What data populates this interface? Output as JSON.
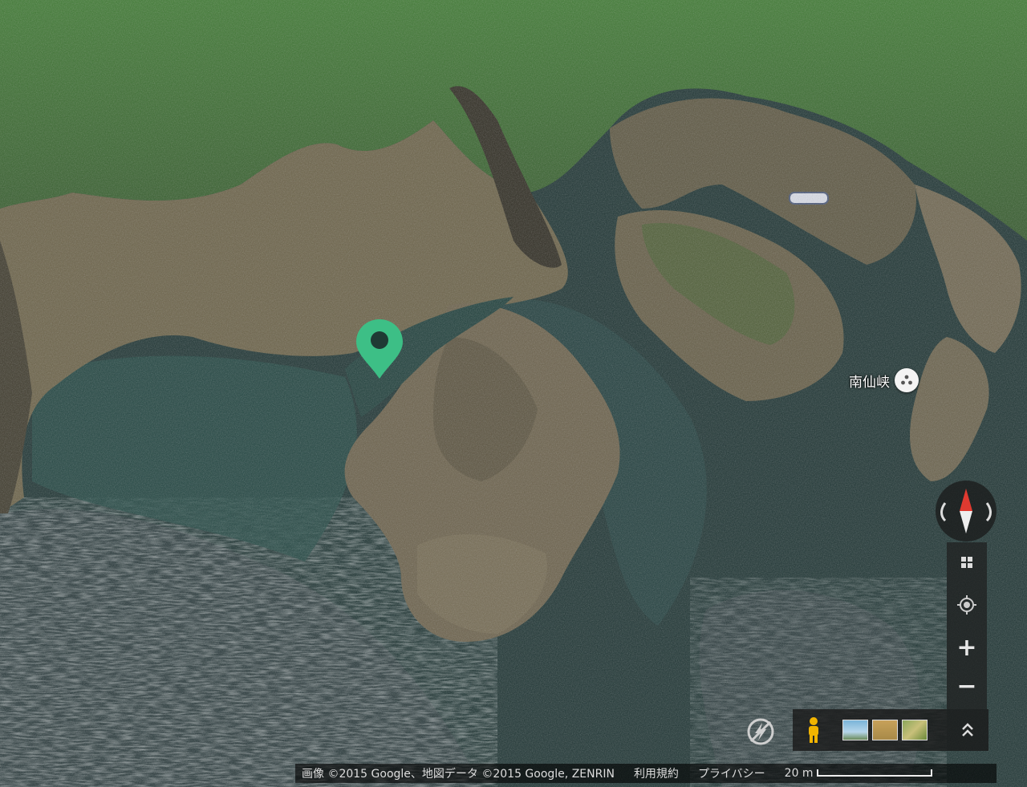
{
  "map": {
    "type": "satellite",
    "places": [
      {
        "label": "南仙峡"
      }
    ],
    "marker": {
      "color": "#3dbf86"
    }
  },
  "controls": {
    "compass": "compass-icon",
    "buttons": [
      {
        "icon": "photos-grid-icon"
      },
      {
        "icon": "my-location-icon"
      },
      {
        "icon": "zoom-in-icon",
        "symbol": "+"
      },
      {
        "icon": "zoom-out-icon",
        "symbol": "−"
      }
    ],
    "instant": "instant-off-icon",
    "pegman": "pegman-icon",
    "expand": "chevron-up-double-icon"
  },
  "footer": {
    "attribution": "画像 ©2015 Google、地図データ ©2015 Google, ZENRIN",
    "terms": "利用規約",
    "privacy": "プライバシー",
    "scale": "20 m"
  },
  "colors": {
    "sea": "#1f3a38",
    "forest": "#3d6b2f",
    "rock": "#6b6148",
    "marker": "#3dbf86"
  }
}
